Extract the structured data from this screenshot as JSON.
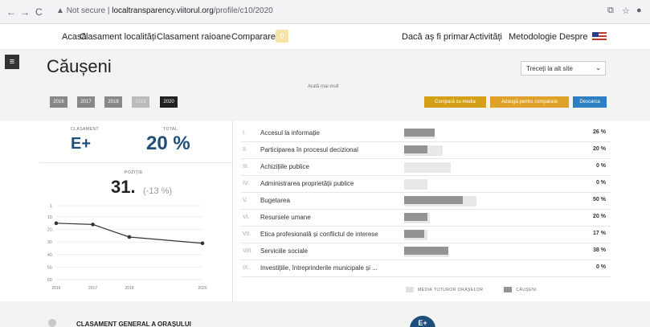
{
  "browser": {
    "back": "←",
    "forward": "→",
    "reload": "C",
    "security": "Not secure",
    "url_host": "localtransparency.viitorul.org",
    "url_path": "/profile/c10/2020"
  },
  "topnav": {
    "left": [
      "Acasă",
      "Clasament localități",
      "Clasament raioane",
      "Comparare"
    ],
    "compare_count": "0",
    "right": [
      "Dacă aș fi primar",
      "Activități",
      "Metodologie",
      "Despre"
    ]
  },
  "header": {
    "title": "Căușeni",
    "more": "Arată mai mult",
    "site_select": "Treceți la alt site",
    "years": [
      "2016",
      "2017",
      "2018",
      "2019",
      "2020"
    ],
    "actions": {
      "compare_avg": "Compară cu media",
      "add_compare": "Adaugă pentru comparare",
      "download": "Descarca"
    }
  },
  "summary": {
    "ranking_label": "CLASAMENT",
    "grade": "E+",
    "total_label": "TOTAL",
    "total": "20 %",
    "position_label": "POZIȚIE",
    "position": "31.",
    "position_delta": "(-13 %)"
  },
  "chart_data": {
    "type": "line",
    "x": [
      "2016",
      "2017",
      "2018",
      "2020"
    ],
    "y": [
      15,
      16,
      26,
      31
    ],
    "yticks": [
      "1.",
      "10.",
      "20.",
      "30.",
      "40.",
      "50.",
      "60."
    ],
    "ylim": [
      1,
      60
    ],
    "inverted": true
  },
  "indicators": [
    {
      "num": "I.",
      "label": "Accesul la informație",
      "value": 26,
      "media": 26,
      "pct": "26 %"
    },
    {
      "num": "II.",
      "label": "Participarea în procesul decizional",
      "value": 20,
      "media": 33,
      "pct": "20 %"
    },
    {
      "num": "III.",
      "label": "Achizițiile publice",
      "value": 0,
      "media": 40,
      "pct": "0 %"
    },
    {
      "num": "IV.",
      "label": "Administrarea proprietății publice",
      "value": 0,
      "media": 20,
      "pct": "0 %"
    },
    {
      "num": "V.",
      "label": "Bugetarea",
      "value": 50,
      "media": 62,
      "pct": "50 %"
    },
    {
      "num": "VI.",
      "label": "Resursele umane",
      "value": 20,
      "media": 22,
      "pct": "20 %"
    },
    {
      "num": "VII.",
      "label": "Etica profesională și conflictul de interese",
      "value": 17,
      "media": 20,
      "pct": "17 %"
    },
    {
      "num": "VIII.",
      "label": "Serviciile sociale",
      "value": 38,
      "media": 38,
      "pct": "38 %"
    },
    {
      "num": "IX.",
      "label": "Investițiile, întreprinderile municipale și ...",
      "value": 0,
      "media": 0,
      "pct": "0 %"
    }
  ],
  "legend": {
    "media": "MEDIA TUTUROR ORAȘELOR",
    "city": "CĂUȘENI"
  },
  "bottom": {
    "heading": "CLASAMENT GENERAL A ORAȘULUI",
    "badge": "E+"
  },
  "colors": {
    "accent_blue": "#1f4e7a",
    "gold": "#d4a017",
    "orange": "#e0a12b",
    "download_blue": "#2d7fc1"
  }
}
